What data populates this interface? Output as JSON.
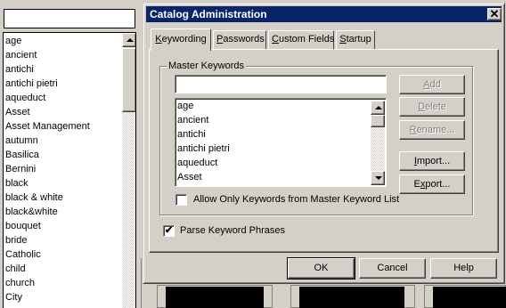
{
  "left_panel": {
    "search_value": "",
    "keywords": [
      "age",
      "ancient",
      "antichi",
      "antichi pietri",
      "aqueduct",
      "Asset",
      "Asset Management",
      "autumn",
      "Basilica",
      "Bernini",
      "black",
      "black & white",
      "black&white",
      "bouquet",
      "bride",
      "Catholic",
      "child",
      "church",
      "City"
    ]
  },
  "dialog": {
    "title": "Catalog Administration",
    "close_glyph": "✕",
    "tabs": [
      "Keywording",
      "Passwords",
      "Custom Fields",
      "Startup"
    ],
    "active_tab": "Keywording",
    "group_label": "Master Keywords",
    "master_input_value": "",
    "master_keywords": [
      "age",
      "ancient",
      "antichi",
      "antichi pietri",
      "aqueduct",
      "Asset"
    ],
    "buttons": {
      "add": "Add",
      "delete": "Delete",
      "rename": "Rename...",
      "import": "Import...",
      "export": "Export..."
    },
    "allow_only_label": "Allow Only Keywords from Master Keyword List",
    "allow_only_checked": false,
    "parse_label": "Parse Keyword Phrases",
    "parse_checked": true,
    "check_glyph": "✔",
    "ok": "OK",
    "cancel": "Cancel",
    "help": "Help"
  },
  "colors": {
    "titlebar": "#0a246a",
    "face": "#d4d0c8"
  }
}
